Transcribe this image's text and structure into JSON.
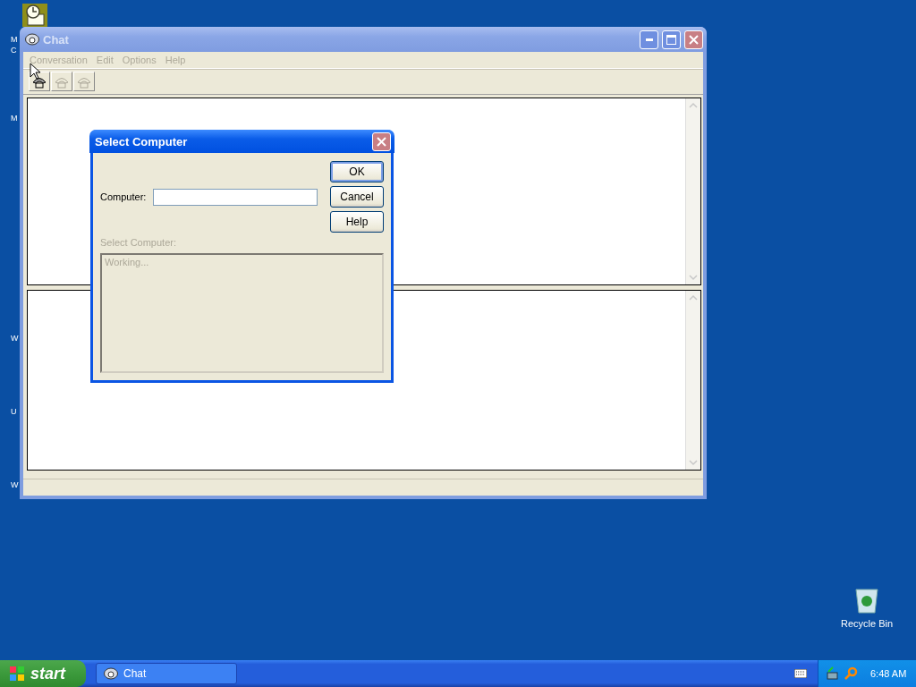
{
  "desktop": {
    "top_icon": {
      "selected": true,
      "label_lines": [
        "M",
        "C"
      ]
    },
    "label_fragments": [
      "M",
      "W",
      "U",
      "W"
    ],
    "recycle_bin": {
      "label": "Recycle Bin"
    }
  },
  "chat_window": {
    "title": "Chat",
    "active": false,
    "menu": [
      {
        "label": "Conversation",
        "disabled": true
      },
      {
        "label": "Edit",
        "disabled": true
      },
      {
        "label": "Options",
        "disabled": true
      },
      {
        "label": "Help",
        "disabled": true
      }
    ],
    "toolbar": [
      {
        "disabled": false
      },
      {
        "disabled": true
      },
      {
        "disabled": true
      }
    ]
  },
  "dialog": {
    "title": "Select Computer",
    "active": true,
    "field_label": "Computer:",
    "buttons": [
      {
        "label": "OK",
        "default": true
      },
      {
        "label": "Cancel",
        "default": false
      },
      {
        "label": "Help",
        "default": false
      }
    ],
    "list_label": {
      "text": "Select Computer:",
      "disabled": true
    },
    "list": {
      "text": "Working...",
      "disabled": true
    }
  },
  "taskbar": {
    "start": "start",
    "tasks": [
      {
        "label": "Chat",
        "selected": false
      }
    ],
    "clock": "6:48 AM"
  }
}
